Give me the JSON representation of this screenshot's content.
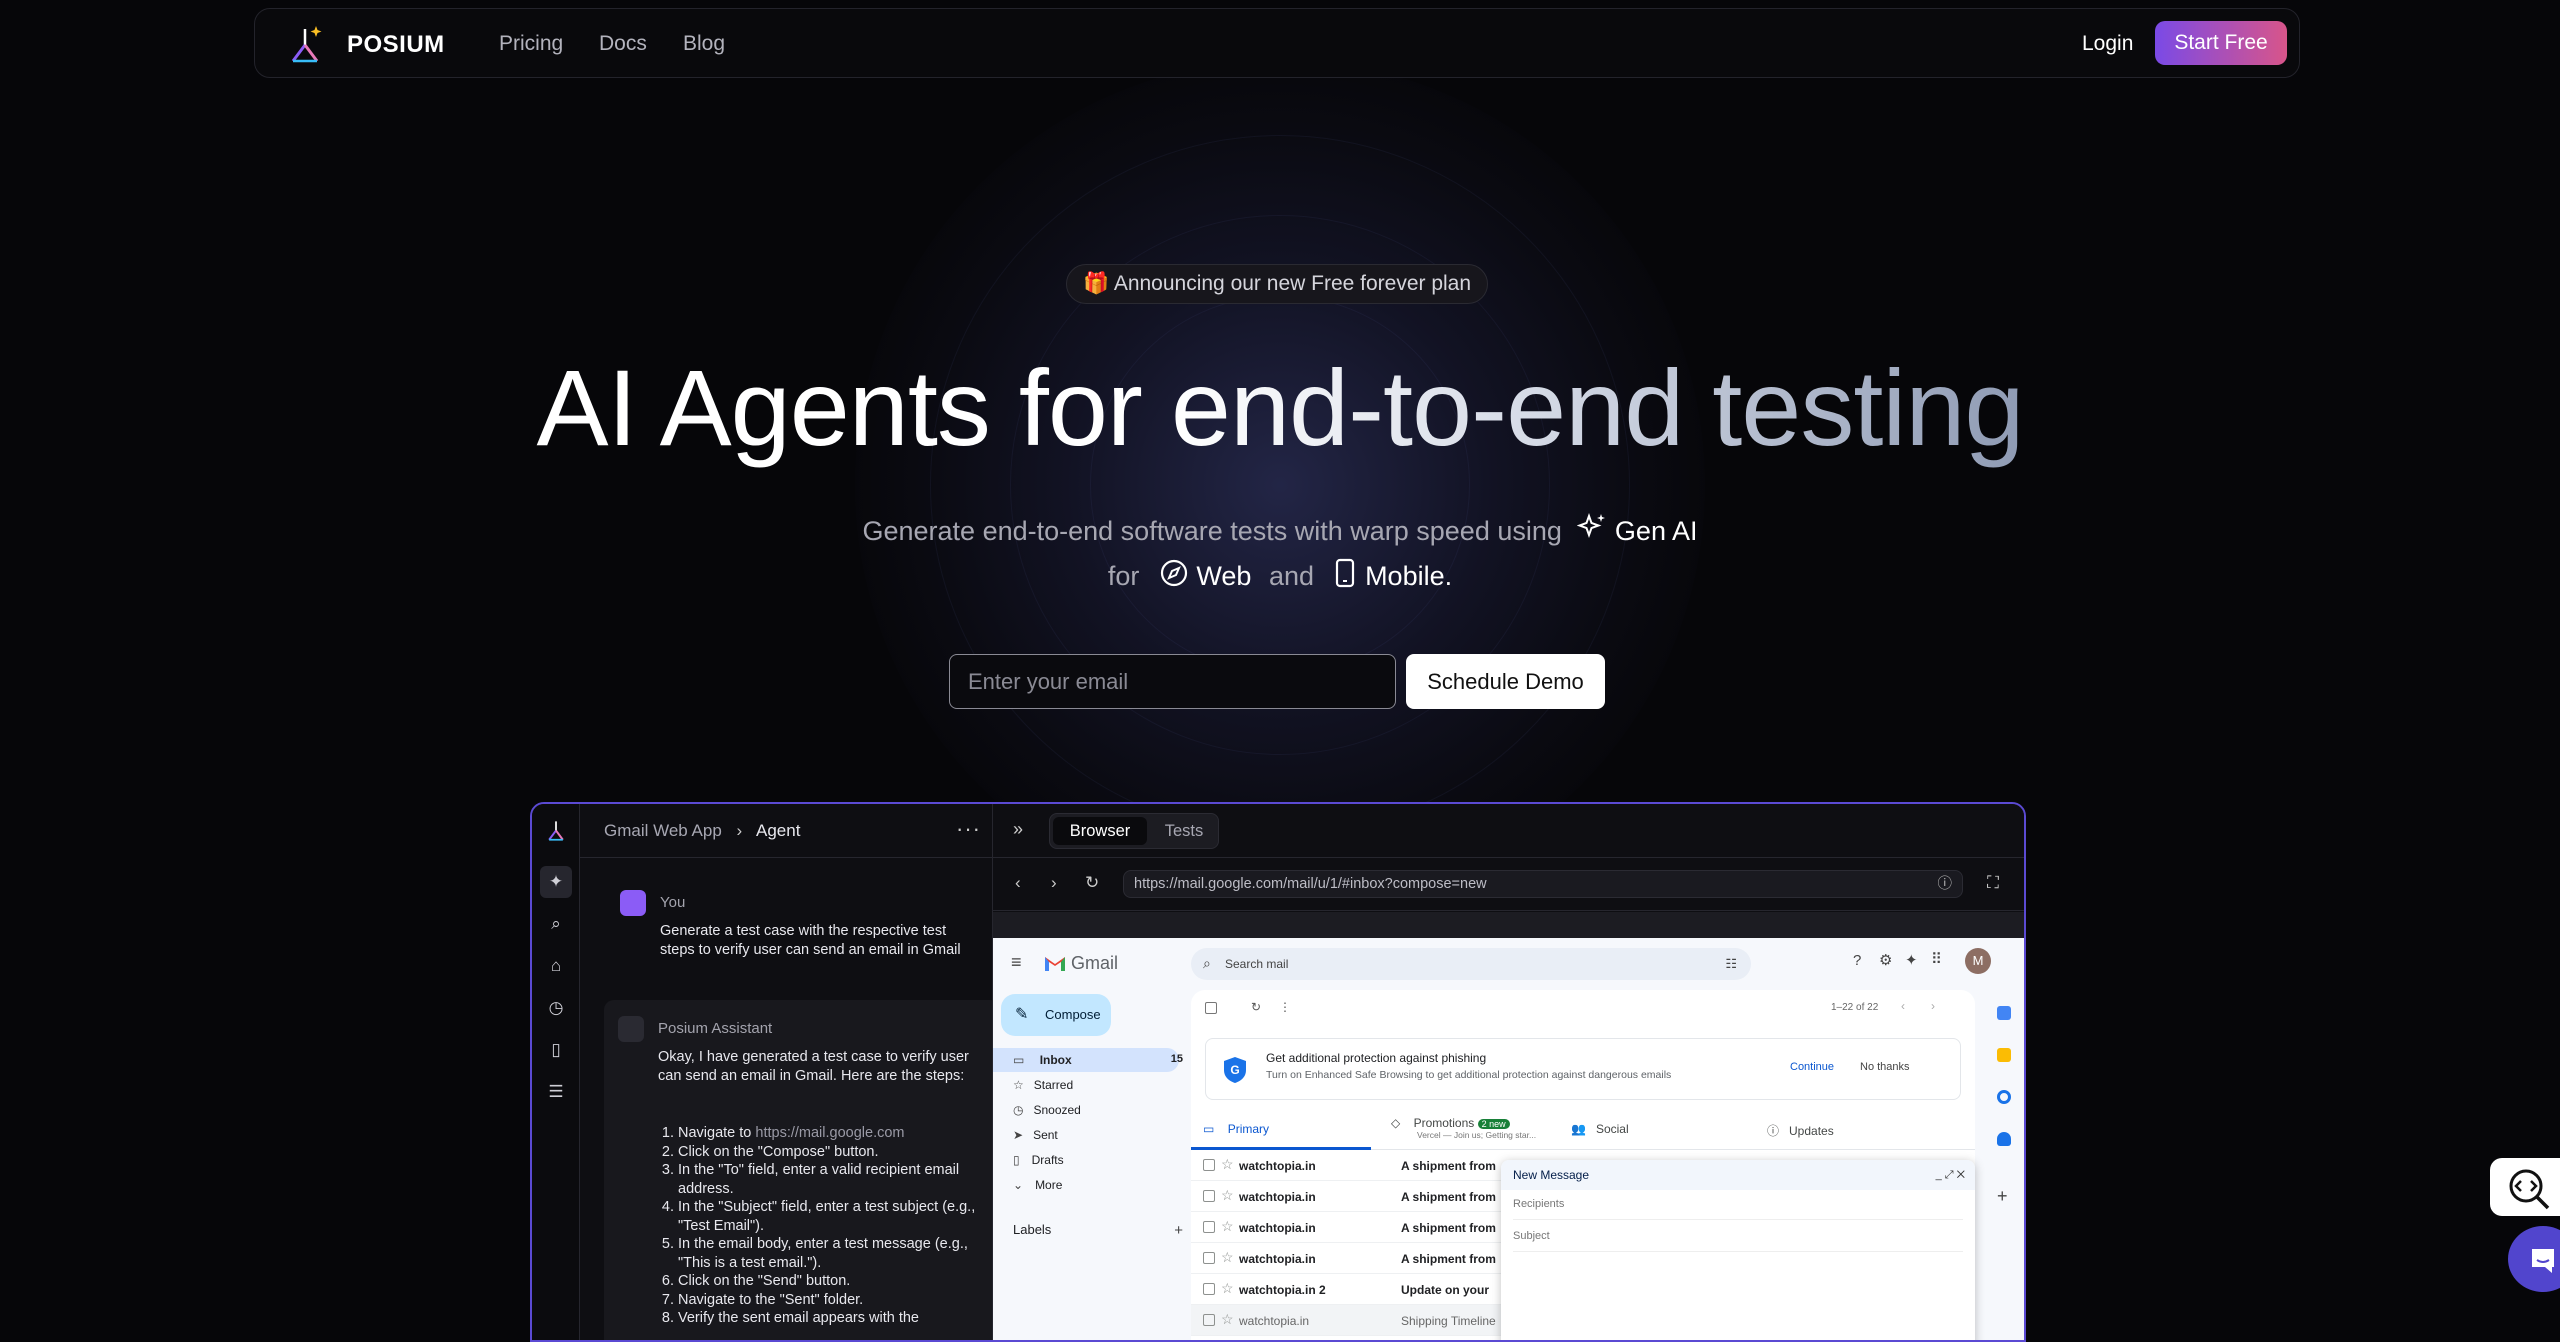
{
  "nav": {
    "brand": "POSIUM",
    "links": [
      "Pricing",
      "Docs",
      "Blog"
    ],
    "login": "Login",
    "start_free": "Start Free"
  },
  "hero": {
    "announcement_emoji": "🎁",
    "announcement": "Announcing our new Free forever plan",
    "title_part1": "AI Agents for",
    "title_part2": "end-to-end testing",
    "subtitle_line1": "Generate end-to-end software tests with warp speed using",
    "gen_ai": "Gen AI",
    "for": "for",
    "web": "Web",
    "and": "and",
    "mobile": "Mobile.",
    "email_placeholder": "Enter your email",
    "schedule_demo": "Schedule Demo"
  },
  "app": {
    "breadcrumb_project": "Gmail Web App",
    "breadcrumb_current": "Agent",
    "user_name": "You",
    "user_message": "Generate a test case with the respective test steps to verify user can send an email in Gmail",
    "assistant_name": "Posium Assistant",
    "assistant_intro": "Okay, I have generated a test case to verify user can send an email in Gmail. Here are the steps:",
    "steps": [
      "Navigate to ",
      "Click on the \"Compose\" button.",
      "In the \"To\" field, enter a valid recipient email address.",
      "In the \"Subject\" field, enter a test subject (e.g., \"Test Email\").",
      "In the email body, enter a test message (e.g., \"This is a test email.\").",
      "Click on the \"Send\" button.",
      "Navigate to the \"Sent\" folder.",
      "Verify the sent email appears with the"
    ],
    "step1_link": "https://mail.google.com",
    "tabs": {
      "browser": "Browser",
      "tests": "Tests"
    },
    "url": "https://mail.google.com/mail/u/1/#inbox?compose=new"
  },
  "gmail": {
    "logo": "Gmail",
    "search_placeholder": "Search mail",
    "compose": "Compose",
    "nav": [
      {
        "label": "Inbox",
        "count": "15"
      },
      {
        "label": "Starred",
        "count": ""
      },
      {
        "label": "Snoozed",
        "count": ""
      },
      {
        "label": "Sent",
        "count": ""
      },
      {
        "label": "Drafts",
        "count": ""
      },
      {
        "label": "More",
        "count": ""
      }
    ],
    "labels_heading": "Labels",
    "pagination": "1–22 of 22",
    "banner_title": "Get additional protection against phishing",
    "banner_text": "Turn on Enhanced Safe Browsing to get additional protection against dangerous emails",
    "banner_continue": "Continue",
    "banner_dismiss": "No thanks",
    "tabs": [
      "Primary",
      "Promotions",
      "Social",
      "Updates"
    ],
    "promotions_badge": "2 new",
    "promotions_sub": "Vercel — Join us; Getting star...",
    "rows": [
      {
        "from": "watchtopia.in",
        "subject": "A shipment from"
      },
      {
        "from": "watchtopia.in",
        "subject": "A shipment from"
      },
      {
        "from": "watchtopia.in",
        "subject": "A shipment from"
      },
      {
        "from": "watchtopia.in",
        "subject": "A shipment from"
      },
      {
        "from": "watchtopia.in 2",
        "subject": "Update on your"
      },
      {
        "from": "watchtopia.in",
        "subject": "Shipping Timeline"
      }
    ],
    "new_message_title": "New Message",
    "recipients_placeholder": "Recipients",
    "subject_placeholder": "Subject",
    "avatar_letter": "M"
  },
  "colors": {
    "accent_start": "#7a4ae6",
    "accent_end": "#d8558a",
    "frame_border": "#5b4ad3",
    "chat_fab": "#5145cd"
  }
}
